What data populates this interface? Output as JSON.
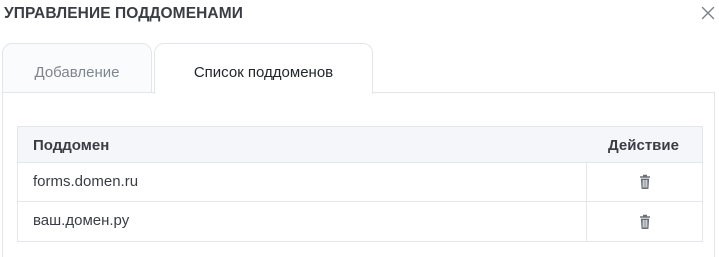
{
  "dialog": {
    "title": "УПРАВЛЕНИЕ ПОДДОМЕНАМИ"
  },
  "tabs": [
    {
      "label": "Добавление",
      "active": false
    },
    {
      "label": "Список поддоменов",
      "active": true
    }
  ],
  "table": {
    "headers": {
      "subdomain": "Поддомен",
      "action": "Действие"
    },
    "rows": [
      {
        "subdomain": "forms.domen.ru",
        "action_icon": "trash-icon"
      },
      {
        "subdomain": "ваш.домен.ру",
        "action_icon": "trash-icon"
      }
    ]
  },
  "colors": {
    "border": "#e3e6ea",
    "header_bg": "#f4f6f9",
    "text": "#3a3e44",
    "icon": "#6a7078"
  }
}
